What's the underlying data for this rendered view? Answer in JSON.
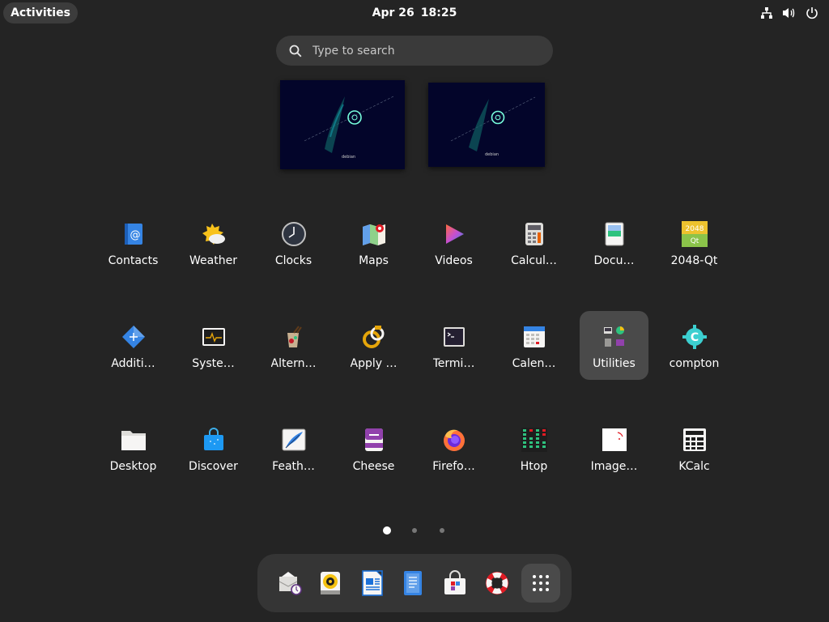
{
  "topbar": {
    "activities_label": "Activities",
    "date": "Apr 26",
    "time": "18:25",
    "tray_icons": [
      "network-icon",
      "volume-icon",
      "power-icon"
    ]
  },
  "search": {
    "placeholder": "Type to search"
  },
  "workspace_label": "debian",
  "apps": [
    {
      "label": "Contacts",
      "icon": "contacts-icon"
    },
    {
      "label": "Weather",
      "icon": "weather-icon"
    },
    {
      "label": "Clocks",
      "icon": "clocks-icon"
    },
    {
      "label": "Maps",
      "icon": "maps-icon"
    },
    {
      "label": "Videos",
      "icon": "videos-icon"
    },
    {
      "label": "Calcul…",
      "icon": "calculator-icon"
    },
    {
      "label": "Docu…",
      "icon": "document-viewer-icon"
    },
    {
      "label": "2048-Qt",
      "icon": "game-2048-icon"
    },
    {
      "label": "Additi…",
      "icon": "additional-drivers-icon"
    },
    {
      "label": "Syste…",
      "icon": "system-monitor-icon"
    },
    {
      "label": "Altern…",
      "icon": "alternatives-icon"
    },
    {
      "label": "Apply …",
      "icon": "apply-patch-icon"
    },
    {
      "label": "Termi…",
      "icon": "terminal-icon"
    },
    {
      "label": "Calen…",
      "icon": "calendar-icon"
    },
    {
      "label": "Utilities",
      "icon": "utilities-folder-icon",
      "selected": true
    },
    {
      "label": "compton",
      "icon": "compton-icon"
    },
    {
      "label": "Desktop",
      "icon": "desktop-folder-icon"
    },
    {
      "label": "Discover",
      "icon": "discover-icon"
    },
    {
      "label": "Feath…",
      "icon": "feather-icon"
    },
    {
      "label": "Cheese",
      "icon": "cheese-icon"
    },
    {
      "label": "Firefo…",
      "icon": "firefox-icon"
    },
    {
      "label": "Htop",
      "icon": "htop-icon"
    },
    {
      "label": "Image…",
      "icon": "image-viewer-icon"
    },
    {
      "label": "KCalc",
      "icon": "kcalc-icon"
    }
  ],
  "pagination": {
    "pages": 3,
    "current": 1
  },
  "dock": {
    "items": [
      "evolution-mail-icon",
      "rhythmbox-icon",
      "writer-icon",
      "text-editor-icon",
      "software-icon",
      "help-icon",
      "show-apps-icon"
    ]
  },
  "colors": {
    "background": "#242424",
    "selected_tile": "#4a4a4a",
    "dock": "#353535"
  }
}
